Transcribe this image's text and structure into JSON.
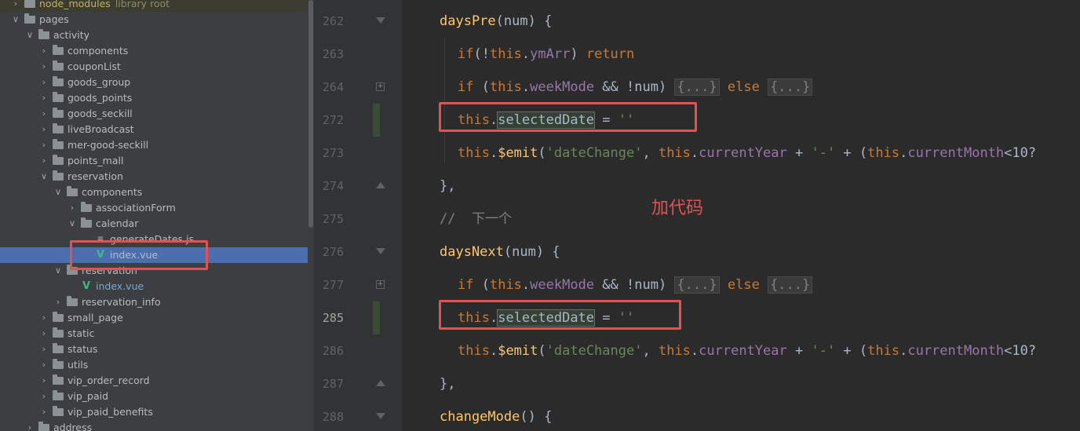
{
  "tree": {
    "items": [
      {
        "name": "node_modules",
        "suffix": "library root",
        "depth": 1,
        "chevron": ">",
        "icon": "folder",
        "style": "yellow",
        "top_row": true
      },
      {
        "name": "pages",
        "depth": 1,
        "chevron": "v",
        "icon": "folder"
      },
      {
        "name": "activity",
        "depth": 2,
        "chevron": "v",
        "icon": "folder"
      },
      {
        "name": "components",
        "depth": 3,
        "chevron": ">",
        "icon": "folder"
      },
      {
        "name": "couponList",
        "depth": 3,
        "chevron": ">",
        "icon": "folder"
      },
      {
        "name": "goods_group",
        "depth": 3,
        "chevron": ">",
        "icon": "folder"
      },
      {
        "name": "goods_points",
        "depth": 3,
        "chevron": ">",
        "icon": "folder"
      },
      {
        "name": "goods_seckill",
        "depth": 3,
        "chevron": ">",
        "icon": "folder"
      },
      {
        "name": "liveBroadcast",
        "depth": 3,
        "chevron": ">",
        "icon": "folder"
      },
      {
        "name": "mer-good-seckill",
        "depth": 3,
        "chevron": ">",
        "icon": "folder"
      },
      {
        "name": "points_mall",
        "depth": 3,
        "chevron": ">",
        "icon": "folder"
      },
      {
        "name": "reservation",
        "depth": 3,
        "chevron": "v",
        "icon": "folder"
      },
      {
        "name": "components",
        "depth": 4,
        "chevron": "v",
        "icon": "folder"
      },
      {
        "name": "associationForm",
        "depth": 5,
        "chevron": ">",
        "icon": "folder"
      },
      {
        "name": "calendar",
        "depth": 5,
        "chevron": "v",
        "icon": "folder"
      },
      {
        "name": "generateDates.js",
        "depth": 6,
        "chevron": "",
        "icon": "js"
      },
      {
        "name": "index.vue",
        "depth": 6,
        "chevron": "",
        "icon": "vue",
        "selected": true
      },
      {
        "name": "reservation",
        "depth": 4,
        "chevron": "v",
        "icon": "folder"
      },
      {
        "name": "index.vue",
        "depth": 5,
        "chevron": "",
        "icon": "vue",
        "style": "blue"
      },
      {
        "name": "reservation_info",
        "depth": 4,
        "chevron": ">",
        "icon": "folder"
      },
      {
        "name": "small_page",
        "depth": 3,
        "chevron": ">",
        "icon": "folder"
      },
      {
        "name": "static",
        "depth": 3,
        "chevron": ">",
        "icon": "folder"
      },
      {
        "name": "status",
        "depth": 3,
        "chevron": ">",
        "icon": "folder"
      },
      {
        "name": "utils",
        "depth": 3,
        "chevron": ">",
        "icon": "folder"
      },
      {
        "name": "vip_order_record",
        "depth": 3,
        "chevron": ">",
        "icon": "folder"
      },
      {
        "name": "vip_paid",
        "depth": 3,
        "chevron": ">",
        "icon": "folder"
      },
      {
        "name": "vip_paid_benefits",
        "depth": 3,
        "chevron": ">",
        "icon": "folder"
      },
      {
        "name": "address",
        "depth": 2,
        "chevron": ">",
        "icon": "folder"
      }
    ]
  },
  "editor": {
    "current_line": "285",
    "lines": [
      {
        "no": "262",
        "fold": "tri-down",
        "tokens": [
          [
            "fn",
            "daysPre"
          ],
          [
            "p",
            "(num) {"
          ]
        ],
        "indent": 0
      },
      {
        "no": "263",
        "tokens": [
          [
            "kw",
            "if"
          ],
          [
            "p",
            "(!"
          ],
          [
            "kw",
            "this"
          ],
          [
            "p",
            "."
          ],
          [
            "prop",
            "ymArr"
          ],
          [
            "p",
            ") "
          ],
          [
            "kw",
            "return"
          ]
        ],
        "indent": 1
      },
      {
        "no": "264",
        "fold": "plus",
        "tokens": [
          [
            "kw",
            "if"
          ],
          [
            "p",
            " ("
          ],
          [
            "kw",
            "this"
          ],
          [
            "p",
            "."
          ],
          [
            "prop",
            "weekMode"
          ],
          [
            "p",
            " && !num) "
          ],
          [
            "folded",
            "{...}"
          ],
          [
            "p",
            " "
          ],
          [
            "kw",
            "else"
          ],
          [
            "p",
            " "
          ],
          [
            "folded",
            "{...}"
          ]
        ],
        "indent": 1
      },
      {
        "no": "272",
        "change": true,
        "tokens": [
          [
            "kw",
            "this"
          ],
          [
            "p",
            "."
          ],
          [
            "hl",
            "selectedDate"
          ],
          [
            "p",
            " = "
          ],
          [
            "str",
            "''"
          ]
        ],
        "indent": 1
      },
      {
        "no": "273",
        "tokens": [
          [
            "kw",
            "this"
          ],
          [
            "p",
            "."
          ],
          [
            "fn",
            "$emit"
          ],
          [
            "p",
            "("
          ],
          [
            "str",
            "'dateChange'"
          ],
          [
            "p",
            ", "
          ],
          [
            "kw",
            "this"
          ],
          [
            "p",
            "."
          ],
          [
            "prop",
            "currentYear"
          ],
          [
            "p",
            " + "
          ],
          [
            "str",
            "'-'"
          ],
          [
            "p",
            " + ("
          ],
          [
            "kw",
            "this"
          ],
          [
            "p",
            "."
          ],
          [
            "prop",
            "currentMonth"
          ],
          [
            "p",
            "<10?"
          ]
        ],
        "indent": 1
      },
      {
        "no": "274",
        "fold": "tri-up",
        "tokens": [
          [
            "p",
            "},"
          ]
        ],
        "indent": 0
      },
      {
        "no": "275",
        "tokens": [
          [
            "cmt",
            "//  下一个"
          ]
        ],
        "indent": 0
      },
      {
        "no": "276",
        "fold": "tri-down",
        "tokens": [
          [
            "fn",
            "daysNext"
          ],
          [
            "p",
            "(num) {"
          ]
        ],
        "indent": 0
      },
      {
        "no": "277",
        "fold": "plus",
        "tokens": [
          [
            "kw",
            "if"
          ],
          [
            "p",
            " ("
          ],
          [
            "kw",
            "this"
          ],
          [
            "p",
            "."
          ],
          [
            "prop",
            "weekMode"
          ],
          [
            "p",
            " && !num) "
          ],
          [
            "folded",
            "{...}"
          ],
          [
            "p",
            " "
          ],
          [
            "kw",
            "else"
          ],
          [
            "p",
            " "
          ],
          [
            "folded",
            "{...}"
          ]
        ],
        "indent": 1
      },
      {
        "no": "285",
        "change": true,
        "tokens": [
          [
            "kw",
            "this"
          ],
          [
            "p",
            "."
          ],
          [
            "hl",
            "selectedDate"
          ],
          [
            "p",
            " = "
          ],
          [
            "str",
            "''"
          ]
        ],
        "indent": 1
      },
      {
        "no": "286",
        "tokens": [
          [
            "kw",
            "this"
          ],
          [
            "p",
            "."
          ],
          [
            "fn",
            "$emit"
          ],
          [
            "p",
            "("
          ],
          [
            "str",
            "'dateChange'"
          ],
          [
            "p",
            ", "
          ],
          [
            "kw",
            "this"
          ],
          [
            "p",
            "."
          ],
          [
            "prop",
            "currentYear"
          ],
          [
            "p",
            " + "
          ],
          [
            "str",
            "'-'"
          ],
          [
            "p",
            " + ("
          ],
          [
            "kw",
            "this"
          ],
          [
            "p",
            "."
          ],
          [
            "prop",
            "currentMonth"
          ],
          [
            "p",
            "<10?"
          ]
        ],
        "indent": 1
      },
      {
        "no": "287",
        "fold": "tri-up",
        "tokens": [
          [
            "p",
            "},"
          ]
        ],
        "indent": 0
      },
      {
        "no": "288",
        "fold": "tri-down",
        "tokens": [
          [
            "fn",
            "changeMode"
          ],
          [
            "p",
            "() {"
          ]
        ],
        "indent": 0
      }
    ]
  },
  "annotation": {
    "text": "加代码",
    "color": "#e8504f"
  },
  "colors": {
    "keyword": "#cc7832",
    "function": "#ffc66d",
    "property": "#9876aa",
    "string": "#6a8759",
    "comment": "#808080",
    "highlight_box": "#e8504f"
  }
}
